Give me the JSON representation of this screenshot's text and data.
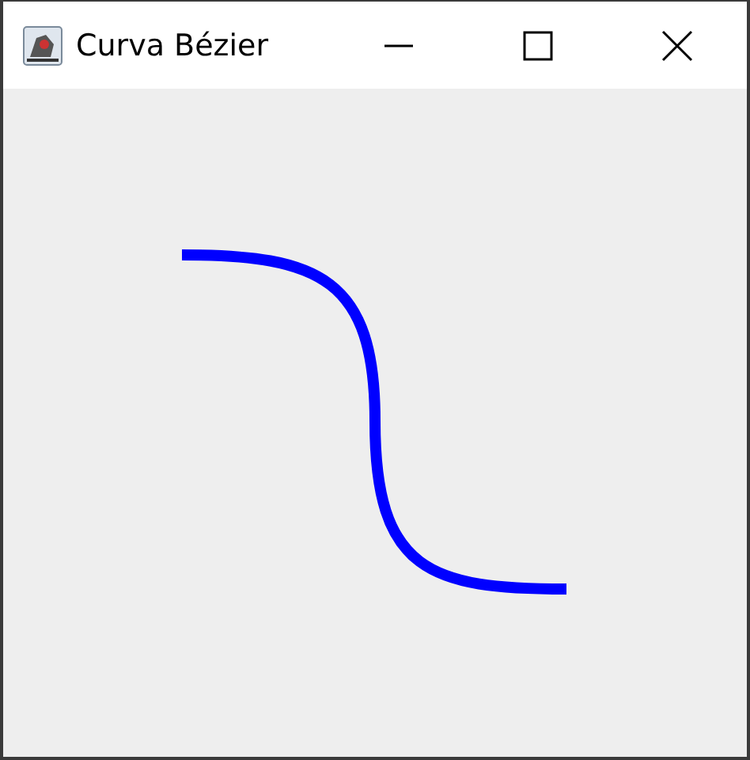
{
  "window": {
    "title": "Curva Bézier"
  }
}
